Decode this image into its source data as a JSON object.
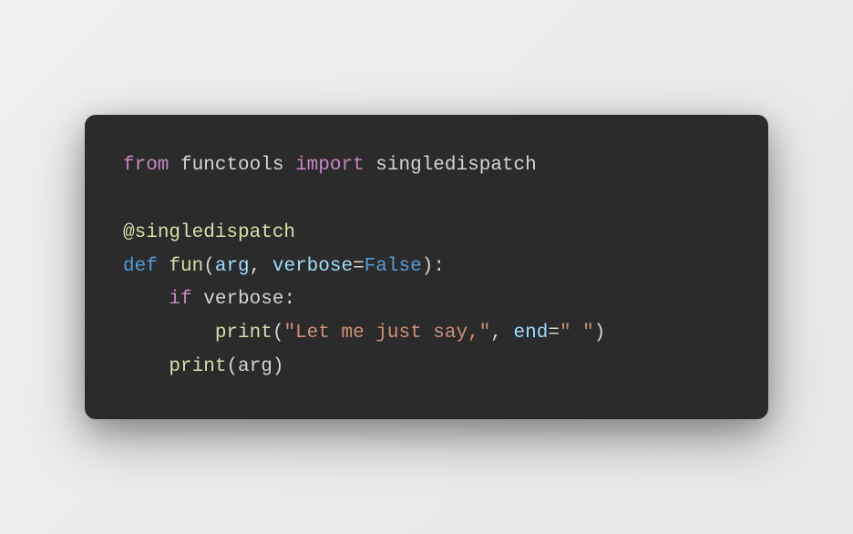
{
  "code": {
    "line1": {
      "from": "from",
      "module": "functools",
      "import": "import",
      "name": "singledispatch"
    },
    "line3": {
      "at": "@",
      "decorator": "singledispatch"
    },
    "line4": {
      "def": "def",
      "funcname": "fun",
      "open": "(",
      "param1": "arg",
      "comma": ", ",
      "param2": "verbose",
      "eq": "=",
      "default": "False",
      "close": "):"
    },
    "line5": {
      "indent": "    ",
      "if": "if",
      "cond": "verbose",
      "colon": ":"
    },
    "line6": {
      "indent": "        ",
      "call": "print",
      "open": "(",
      "str": "\"Let me just say,\"",
      "comma": ", ",
      "kwarg": "end",
      "eq": "=",
      "kwval": "\" \"",
      "close": ")"
    },
    "line7": {
      "indent": "    ",
      "call": "print",
      "open": "(",
      "arg": "arg",
      "close": ")"
    }
  }
}
